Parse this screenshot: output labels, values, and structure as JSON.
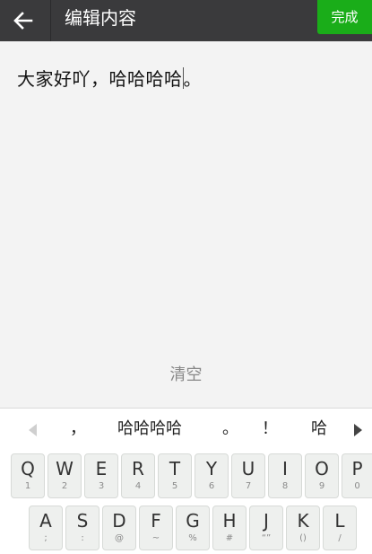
{
  "header": {
    "title": "编辑内容",
    "done_label": "完成"
  },
  "editor": {
    "text": "大家好吖，哈哈哈哈",
    "text_after_cursor": "。",
    "clear_label": "清空"
  },
  "candidates": [
    {
      "label": "，"
    },
    {
      "label": "哈哈哈哈"
    },
    {
      "label": "。"
    },
    {
      "label": "！"
    },
    {
      "label": "哈"
    }
  ],
  "keyboard": {
    "row1": [
      {
        "main": "Q",
        "sub": "1"
      },
      {
        "main": "W",
        "sub": "2"
      },
      {
        "main": "E",
        "sub": "3"
      },
      {
        "main": "R",
        "sub": "4"
      },
      {
        "main": "T",
        "sub": "5"
      },
      {
        "main": "Y",
        "sub": "6"
      },
      {
        "main": "U",
        "sub": "7"
      },
      {
        "main": "I",
        "sub": "8"
      },
      {
        "main": "O",
        "sub": "9"
      },
      {
        "main": "P",
        "sub": "0"
      }
    ],
    "row2": [
      {
        "main": "A",
        "sub": ";"
      },
      {
        "main": "S",
        "sub": ":"
      },
      {
        "main": "D",
        "sub": "@"
      },
      {
        "main": "F",
        "sub": "~"
      },
      {
        "main": "G",
        "sub": "%"
      },
      {
        "main": "H",
        "sub": "#"
      },
      {
        "main": "J",
        "sub": "“”"
      },
      {
        "main": "K",
        "sub": "()"
      },
      {
        "main": "L",
        "sub": "/"
      }
    ]
  },
  "colors": {
    "topbar": "#3a3a3c",
    "accent": "#1aad19",
    "background": "#f2f2f2"
  }
}
